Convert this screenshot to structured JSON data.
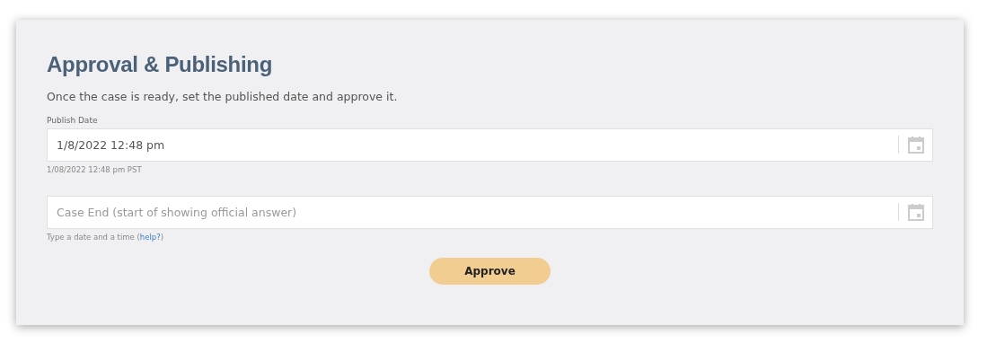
{
  "panel": {
    "title": "Approval & Publishing",
    "description": "Once the case is ready, set the published date and approve it."
  },
  "fields": [
    {
      "label": "Publish Date",
      "value": "1/8/2022 12:48 pm",
      "hint": {
        "text": "1/08/2022 12:48 pm PST"
      }
    },
    {
      "placeholder": "Case End (start of showing official answer)",
      "hint": {
        "text": "Type a date and a time (",
        "link": "help?",
        "after": ")"
      }
    }
  ],
  "button": {
    "label": "Approve"
  }
}
